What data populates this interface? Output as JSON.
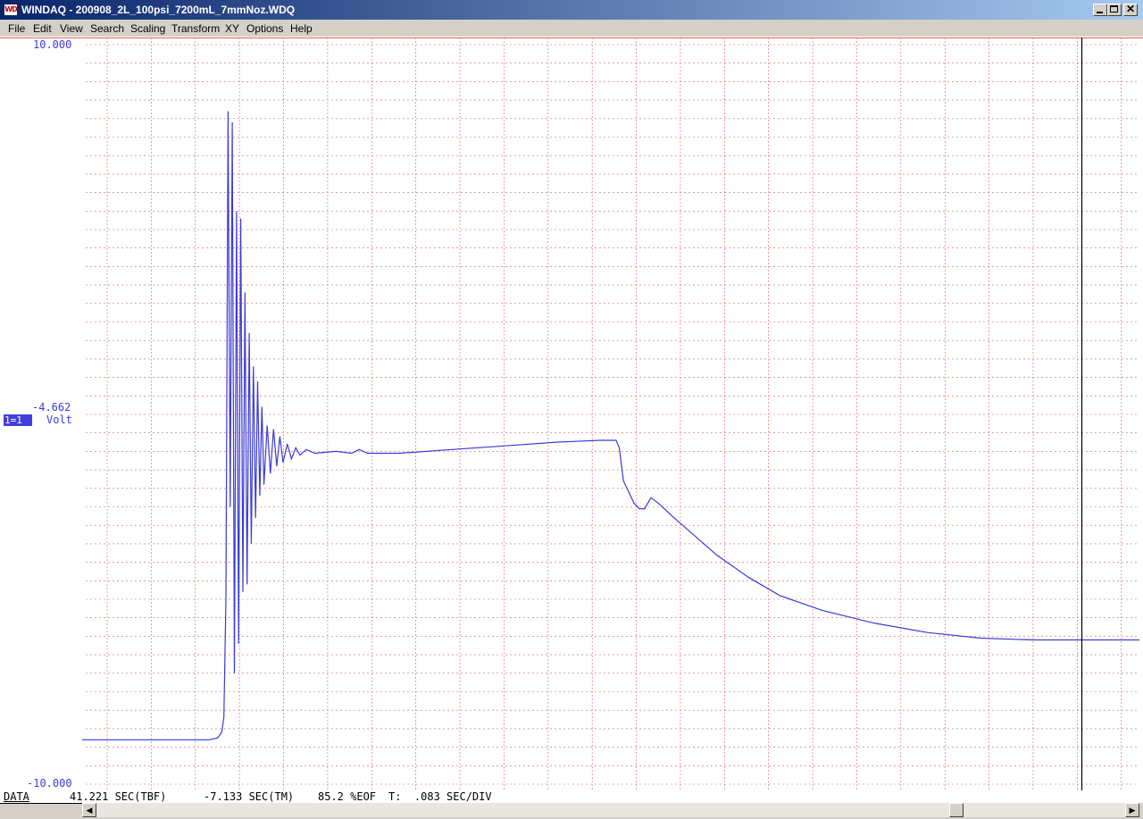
{
  "window": {
    "title": "WINDAQ - 200908_2L_100psi_7200mL_7mmNoz.WDQ",
    "icon_text": "WD"
  },
  "menu": [
    "File",
    "Edit",
    "View",
    "Search",
    "Scaling",
    "Transform",
    "XY",
    "Options",
    "Help"
  ],
  "colors": {
    "trace": "#3a3ad8",
    "grid": "#e06060",
    "cursor": "#000000",
    "channel_badge": "#4040e0"
  },
  "chart": {
    "y_top_label": "10.000",
    "y_bottom_label": "-10.000",
    "cursor_value": "-4.662",
    "channel_label": "1=1",
    "unit_label": "Volt"
  },
  "chart_data": {
    "type": "line",
    "ylim": [
      -10,
      10
    ],
    "xlim": [
      0,
      1
    ],
    "grid": true,
    "series": [
      {
        "points": [
          [
            0.0,
            -8.8
          ],
          [
            0.12,
            -8.8
          ],
          [
            0.128,
            -8.75
          ],
          [
            0.132,
            -8.6
          ],
          [
            0.134,
            -8.2
          ],
          [
            0.136,
            -5.0
          ],
          [
            0.138,
            8.2
          ],
          [
            0.14,
            -2.5
          ],
          [
            0.142,
            7.9
          ],
          [
            0.144,
            -7.0
          ],
          [
            0.146,
            5.5
          ],
          [
            0.148,
            -6.2
          ],
          [
            0.15,
            5.3
          ],
          [
            0.152,
            -4.8
          ],
          [
            0.154,
            3.3
          ],
          [
            0.156,
            -4.6
          ],
          [
            0.158,
            2.2
          ],
          [
            0.16,
            -3.5
          ],
          [
            0.162,
            1.3
          ],
          [
            0.164,
            -2.8
          ],
          [
            0.166,
            0.9
          ],
          [
            0.168,
            -2.2
          ],
          [
            0.17,
            0.2
          ],
          [
            0.172,
            -1.9
          ],
          [
            0.175,
            -0.3
          ],
          [
            0.178,
            -1.6
          ],
          [
            0.181,
            -0.4
          ],
          [
            0.184,
            -1.4
          ],
          [
            0.187,
            -0.6
          ],
          [
            0.19,
            -1.3
          ],
          [
            0.194,
            -0.8
          ],
          [
            0.198,
            -1.2
          ],
          [
            0.202,
            -0.9
          ],
          [
            0.206,
            -1.1
          ],
          [
            0.212,
            -0.95
          ],
          [
            0.22,
            -1.05
          ],
          [
            0.24,
            -1.0
          ],
          [
            0.255,
            -1.05
          ],
          [
            0.262,
            -0.95
          ],
          [
            0.27,
            -1.05
          ],
          [
            0.3,
            -1.05
          ],
          [
            0.35,
            -0.95
          ],
          [
            0.4,
            -0.85
          ],
          [
            0.45,
            -0.75
          ],
          [
            0.49,
            -0.7
          ],
          [
            0.505,
            -0.7
          ],
          [
            0.508,
            -0.9
          ],
          [
            0.512,
            -1.8
          ],
          [
            0.517,
            -2.1
          ],
          [
            0.522,
            -2.4
          ],
          [
            0.527,
            -2.55
          ],
          [
            0.532,
            -2.55
          ],
          [
            0.538,
            -2.25
          ],
          [
            0.545,
            -2.4
          ],
          [
            0.56,
            -2.8
          ],
          [
            0.58,
            -3.3
          ],
          [
            0.6,
            -3.8
          ],
          [
            0.63,
            -4.4
          ],
          [
            0.66,
            -4.9
          ],
          [
            0.7,
            -5.3
          ],
          [
            0.75,
            -5.65
          ],
          [
            0.8,
            -5.9
          ],
          [
            0.85,
            -6.05
          ],
          [
            0.9,
            -6.1
          ],
          [
            0.95,
            -6.1
          ],
          [
            1.0,
            -6.1
          ]
        ]
      }
    ]
  },
  "status": {
    "mode": "DATA",
    "tbf": "41.221 SEC(TBF)",
    "tm": "-7.133 SEC(TM)",
    "eof": "85.2 %EOF",
    "tdiv": "T:  .083 SEC/DIV"
  },
  "scrollbar": {
    "position_percent": 85.2
  },
  "icons": {
    "app": "windaq-app-icon",
    "minimize": "minimize-icon",
    "maximize": "maximize-icon",
    "close": "close-icon",
    "scroll_left": "scroll-left-arrow-icon",
    "scroll_right": "scroll-right-arrow-icon"
  }
}
